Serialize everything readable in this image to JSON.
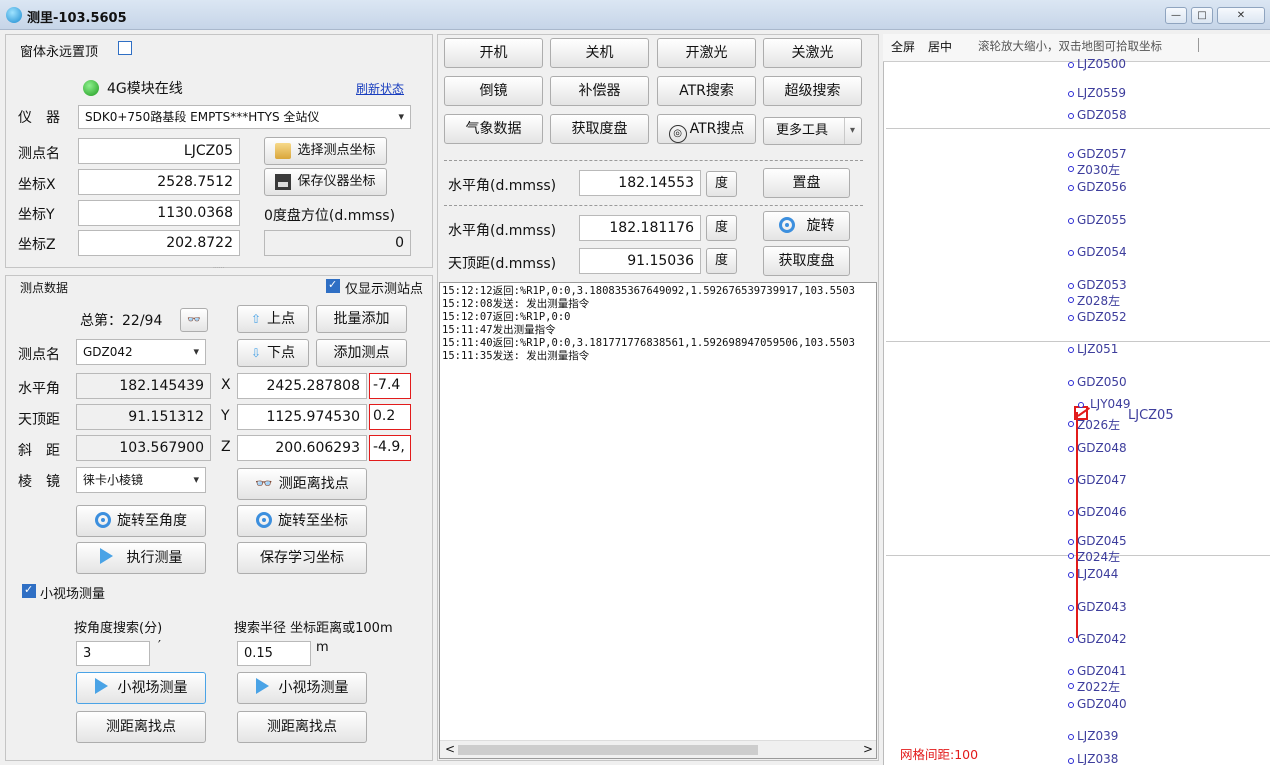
{
  "window": {
    "title": "测里-103.5605",
    "btn_min": "—",
    "btn_max": "□",
    "btn_close": "✕"
  },
  "left": {
    "always_top_label": "窗体永远置顶",
    "module_status": "4G模块在线",
    "refresh_link": "刷新状态",
    "instrument_label": "仪　器",
    "instrument_value": "SDK0+750路基段 EMPTS***HTYS 全站仪",
    "station_name_label": "测点名",
    "station_name_value": "LJCZ05",
    "select_station_btn": "选择测点坐标",
    "coord_x_label": "坐标X",
    "coord_x_value": "2528.7512",
    "save_instr_btn": "保存仪器坐标",
    "coord_y_label": "坐标Y",
    "coord_y_value": "1130.0368",
    "zero_azimuth_label": "0度盘方位(d.mmss)",
    "coord_z_label": "坐标Z",
    "coord_z_value": "202.8722",
    "zero_azimuth_value": "0",
    "resize_grip": "......",
    "section_title": "测点数据",
    "only_station_label": "仅显示测站点",
    "total_label": "总第：22/94",
    "prev_point_btn": "上点",
    "batch_add_btn": "批量添加",
    "point_name_label": "测点名",
    "point_name_value": "GDZ042",
    "next_point_btn": "下点",
    "add_point_btn": "添加测点",
    "hz_label": "水平角",
    "hz_value": "182.145439",
    "x_axis": "X",
    "x_value": "2425.287808",
    "dx_value": "-7.4",
    "zenith_label": "天顶距",
    "zenith_value": "91.151312",
    "y_axis": "Y",
    "y_value": "1125.974530",
    "dy_value": "0.2",
    "slope_label": "斜　距",
    "slope_value": "103.567900",
    "z_axis": "Z",
    "z_value": "200.606293",
    "dz_value": "-4.9,",
    "prism_label": "棱　镜",
    "prism_value": "徕卡小棱镜",
    "find_by_dist_btn": "测距离找点",
    "rotate_angle_btn": "旋转至角度",
    "rotate_coord_btn": "旋转至坐标",
    "exec_measure_btn": "执行测量",
    "save_learn_btn": "保存学习坐标",
    "small_fov_label": "小视场测量",
    "angle_search_label": "按角度搜索(分)",
    "search_radius_label": "搜索半径 坐标距离或100m",
    "angle_search_value": "3",
    "angle_unit": "′",
    "radius_value": "0.15",
    "radius_unit": "m",
    "small_fov_btn1": "小视场测量",
    "small_fov_btn2": "小视场测量",
    "find_dist_btn1": "测距离找点",
    "find_dist_btn2": "测距离找点"
  },
  "middle": {
    "btn_power_on": "开机",
    "btn_power_off": "关机",
    "btn_laser_on": "开激光",
    "btn_laser_off": "关激光",
    "btn_invert": "倒镜",
    "btn_compensator": "补偿器",
    "btn_atr_search": "ATR搜索",
    "btn_super_search": "超级搜索",
    "btn_weather": "气象数据",
    "btn_get_circle": "获取度盘",
    "btn_atr_point": "ATR搜点",
    "btn_more_tools": "更多工具",
    "hz1_label": "水平角(d.mmss)",
    "hz1_value": "182.14553",
    "deg1": "度",
    "set_circle_btn": "置盘",
    "hz2_label": "水平角(d.mmss)",
    "hz2_value": "182.181176",
    "deg2": "度",
    "rotate_btn": "旋转",
    "zen_label": "天顶距(d.mmss)",
    "zen_value": "91.15036",
    "deg3": "度",
    "get_circle_btn2": "获取度盘",
    "log": [
      "15:12:12返回:%R1P,0:0,3.180835367649092,1.592676539739917,103.5503",
      "15:12:08发送: 发出测量指令",
      "15:12:07返回:%R1P,0:0",
      "15:11:47发出测量指令",
      "15:11:40返回:%R1P,0:0,3.181771776838561,1.592698947059506,103.5503",
      "15:11:35发送: 发出测量指令"
    ],
    "scroll_left": "<",
    "scroll_right": ">"
  },
  "map": {
    "fullscreen_btn": "全屏",
    "center_btn": "居中",
    "hint": "滚轮放大缩小，双击地图可拾取坐标",
    "grid_spacing": "网格间距:100",
    "labels": {
      "l1": "LJZ0500",
      "l2": "LJZ0559",
      "l3": "GDZ058",
      "l4": "GDZ057",
      "l5": "Z030左",
      "l6": "GDZ056",
      "l7": "GDZ055",
      "l8": "GDZ054",
      "l9": "GDZ053",
      "l10": "Z028左",
      "l11": "GDZ052",
      "l12": "LJZ051",
      "l13": "GDZ050",
      "l14": "LJY049",
      "l15": "LJCZ05",
      "l16": "Z026左",
      "l17": "GDZ048",
      "l18": "GDZ047",
      "l19": "GDZ046",
      "l20": "GDZ045",
      "l21": "Z024左",
      "l22": "LJZ044",
      "l23": "GDZ043",
      "l24": "GDZ042",
      "l25": "GDZ041",
      "l26": "Z022左",
      "l27": "GDZ040",
      "l28": "LJZ039",
      "l29": "LJZ038"
    },
    "colors": {
      "point": "#2b2bd6",
      "route": "#e21b1b",
      "grid": "#c8c8c8"
    }
  },
  "colors": {
    "accent": "#2f6fc4",
    "status_green": "#2fb12f",
    "error_red": "#e21b1b"
  }
}
